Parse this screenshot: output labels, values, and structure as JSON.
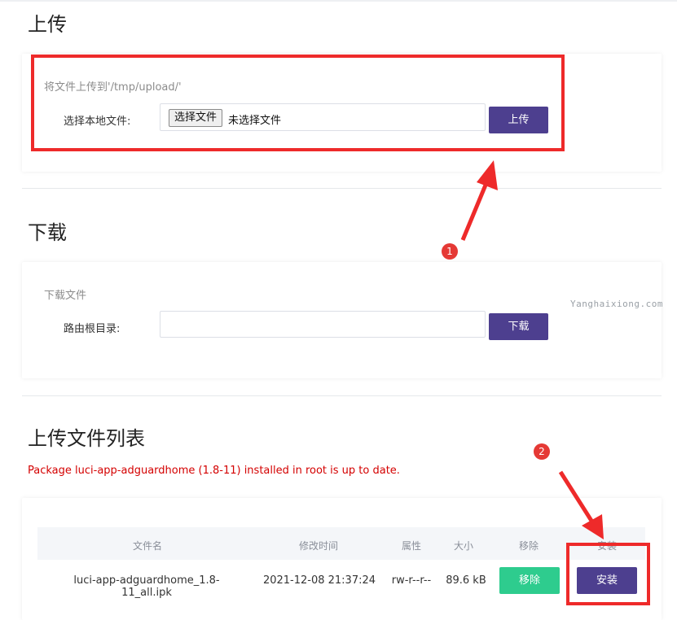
{
  "upload": {
    "title": "上传",
    "hint": "将文件上传到'/tmp/upload/'",
    "local_file_label": "选择本地文件:",
    "choose_file_button": "选择文件",
    "no_file_text": "未选择文件",
    "upload_button": "上传"
  },
  "download": {
    "title": "下载",
    "hint": "下载文件",
    "router_root_label": "路由根目录:",
    "path_value": "",
    "download_button": "下载"
  },
  "watermark": "Yanghaixiong.com",
  "file_list": {
    "title": "上传文件列表",
    "status_message": "Package luci-app-adguardhome (1.8-11) installed in root is up to date.",
    "columns": [
      "文件名",
      "修改时间",
      "属性",
      "大小",
      "移除",
      "安装"
    ],
    "rows": [
      {
        "filename": "luci-app-adguardhome_1.8-11_all.ipk",
        "modified": "2021-12-08 21:37:24",
        "attributes": "rw-r--r--",
        "size": "89.6 kB",
        "remove_label": "移除",
        "install_label": "安装"
      }
    ]
  },
  "annotations": {
    "badge_1": "1",
    "badge_2": "2",
    "annotation_color": "#ee2a2a"
  },
  "colors": {
    "primary_button": "#4d3f8f",
    "remove_button": "#2ecc8e",
    "error_text": "#d40000"
  }
}
